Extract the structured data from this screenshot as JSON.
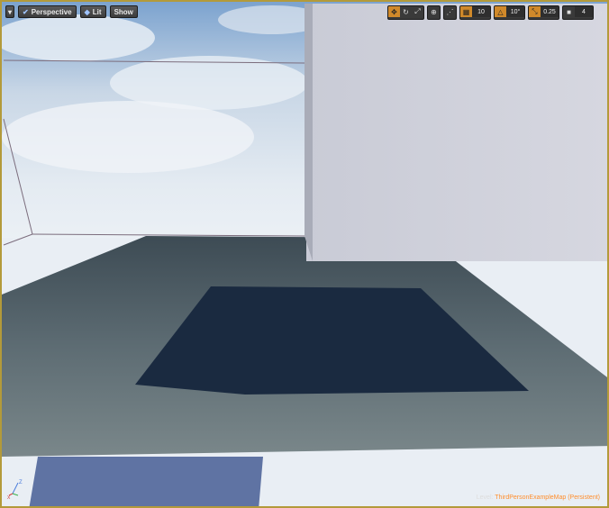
{
  "toolbar": {
    "menu_icon": "chevron-down-icon",
    "perspective_label": "Perspective",
    "lit_label": "Lit",
    "show_label": "Show"
  },
  "right_toolbar": {
    "grid_snap_value": "10",
    "rotation_snap_value": "10°",
    "scale_snap_value": "0.25",
    "camera_speed_value": "4"
  },
  "status": {
    "level_prefix": "Level:",
    "level_name": "ThirdPersonExampleMap (Persistent)"
  },
  "axis": {
    "z": "Z",
    "x": "X"
  },
  "colors": {
    "accent": "#d0892a",
    "border": "#b39a3a"
  }
}
